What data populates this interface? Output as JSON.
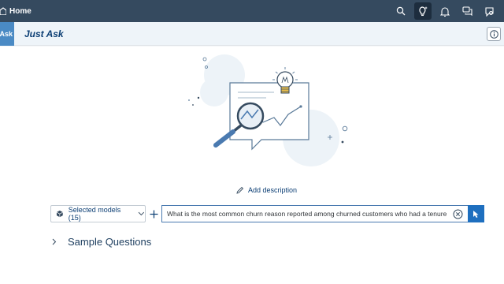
{
  "topbar": {
    "home_label": "Home",
    "icons": [
      "search-icon",
      "lightbulb-ai-icon",
      "bell-icon",
      "chat-icon",
      "help-chat-icon"
    ],
    "active_icon": "lightbulb-ai-icon",
    "bg_color": "#354a5f"
  },
  "subheader": {
    "badge_label": "Ask",
    "title": "Just Ask",
    "info_icon": "info-icon"
  },
  "main": {
    "add_description_label": "Add description",
    "models_label": "Selected models (15)",
    "query_text": "What is the most common churn reason reported among churned customers who had a tenure of le",
    "sample_questions_label": "Sample Questions"
  },
  "colors": {
    "accent": "#1e6fbf",
    "title": "#0a3d73"
  }
}
